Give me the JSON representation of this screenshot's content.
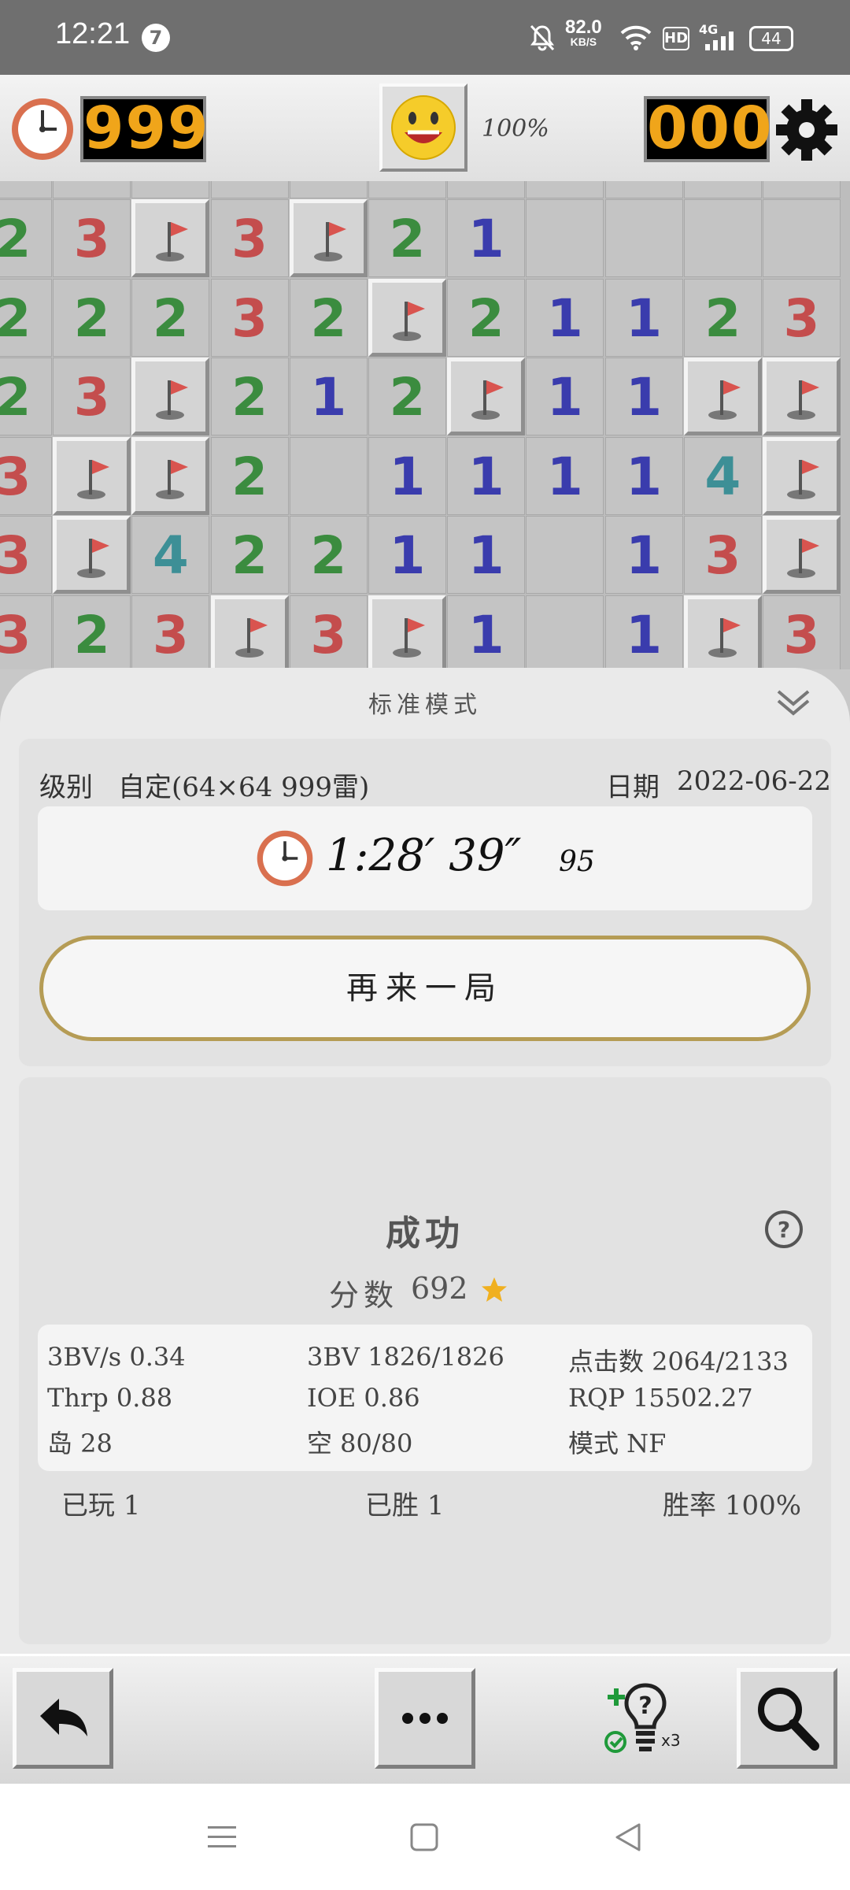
{
  "status_bar": {
    "time": "12:21",
    "notification_count": "7",
    "net_speed": "82.0",
    "net_unit": "KB/S",
    "hd": "HD",
    "signal": "4G",
    "battery": "44"
  },
  "game_bar": {
    "timer_value": "999",
    "progress": "100%",
    "mine_counter": "000"
  },
  "board": {
    "rows": [
      [
        "2",
        "3",
        "F",
        "3",
        "F",
        "2",
        "1",
        "",
        "",
        "",
        ""
      ],
      [
        "2",
        "2",
        "2",
        "3",
        "2",
        "F",
        "2",
        "1",
        "1",
        "2",
        "3"
      ],
      [
        "2",
        "3",
        "F",
        "2",
        "1",
        "2",
        "F",
        "1",
        "1",
        "F",
        "F"
      ],
      [
        "3",
        "F",
        "F",
        "2",
        "",
        "1",
        "1",
        "1",
        "1",
        "4",
        "F"
      ],
      [
        "3",
        "F",
        "4",
        "2",
        "2",
        "1",
        "1",
        "",
        "1",
        "3",
        "F"
      ],
      [
        "3",
        "2",
        "3",
        "F",
        "3",
        "F",
        "1",
        "",
        "1",
        "F",
        "3"
      ]
    ],
    "number_colors": {
      "1": "#3a3cad",
      "2": "#3b8c3f",
      "3": "#c44d4d",
      "4": "#3d8f96"
    }
  },
  "result_sheet": {
    "mode_title": "标准模式",
    "level_label": "级别",
    "level_value": "自定(64×64 999雷)",
    "date_label": "日期",
    "date_value": "2022-06-22",
    "time_main": "1:28′ 39″",
    "time_fraction": "95",
    "play_again": "再来一局",
    "result": "成功",
    "score_label": "分数",
    "score_value": "692",
    "stats": {
      "bv_per_s": "3BV/s 0.34",
      "bv": "3BV 1826/1826",
      "clicks": "点击数 2064/2133",
      "thrp": "Thrp 0.88",
      "ioe": "IOE 0.86",
      "rqp": "RQP 15502.27",
      "islands": "岛 28",
      "openings": "空 80/80",
      "mode": "模式 NF"
    },
    "played": "已玩 1",
    "won": "已胜 1",
    "win_rate": "胜率 100%"
  },
  "toolbar": {
    "hint_count": "x3"
  },
  "accent_color": "#f0a51a"
}
